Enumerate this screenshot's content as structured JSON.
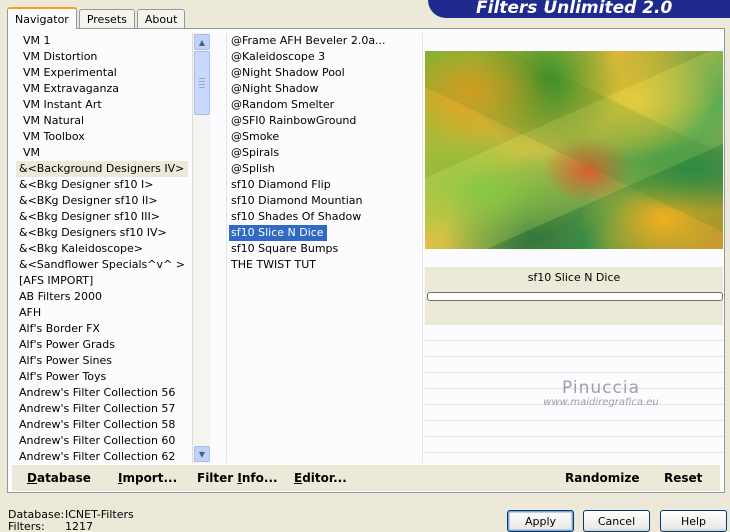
{
  "tabs": [
    "Navigator",
    "Presets",
    "About"
  ],
  "banner_title": "Filters Unlimited 2.0",
  "categories": [
    "VM 1",
    "VM Distortion",
    "VM Experimental",
    "VM Extravaganza",
    "VM Instant Art",
    "VM Natural",
    "VM Toolbox",
    "VM",
    "&<Background Designers IV>",
    "&<Bkg Designer sf10 I>",
    "&<BKg Designer sf10 II>",
    "&<Bkg Designer sf10 III>",
    "&<Bkg Designers sf10 IV>",
    "&<Bkg Kaleidoscope>",
    "&<Sandflower Specials^v^ >",
    "[AFS IMPORT]",
    "AB Filters 2000",
    "AFH",
    "Alf's Border FX",
    "Alf's Power Grads",
    "Alf's Power Sines",
    "Alf's Power Toys",
    "Andrew's Filter Collection 56",
    "Andrew's Filter Collection 57",
    "Andrew's Filter Collection 58",
    "Andrew's Filter Collection 60",
    "Andrew's Filter Collection 62"
  ],
  "filters": [
    "@Frame AFH Beveler 2.0a...",
    "@Kaleidoscope 3",
    "@Night Shadow Pool",
    "@Night Shadow",
    "@Random Smelter",
    "@SFI0 RainbowGround",
    "@Smoke",
    "@Spirals",
    "@Splish",
    "sf10 Diamond Flip",
    "sf10 Diamond Mountian",
    "sf10 Shades Of Shadow",
    "sf10 Slice N Dice",
    "sf10 Square Bumps",
    "THE TWIST TUT"
  ],
  "selected_filter_name": "sf10 Slice N Dice",
  "watermark": {
    "line1": "Pinuccia",
    "line2": "www.maidiregrafica.eu"
  },
  "bottom_buttons": {
    "database": {
      "underlined": "D",
      "rest": "atabase"
    },
    "import": {
      "underlined": "I",
      "rest": "mport..."
    },
    "filter_info": {
      "before": "Filter ",
      "underlined": "I",
      "rest": "nfo..."
    },
    "editor": {
      "underlined": "E",
      "rest": "ditor..."
    },
    "randomize": "Randomize",
    "reset": "Reset"
  },
  "status": {
    "database_label": "Database:",
    "database_value": "ICNET-Filters",
    "filters_label": "Filters:",
    "filters_value": "1217"
  },
  "dialog_buttons": {
    "apply": "Apply",
    "cancel": "Cancel",
    "help": "Help"
  }
}
